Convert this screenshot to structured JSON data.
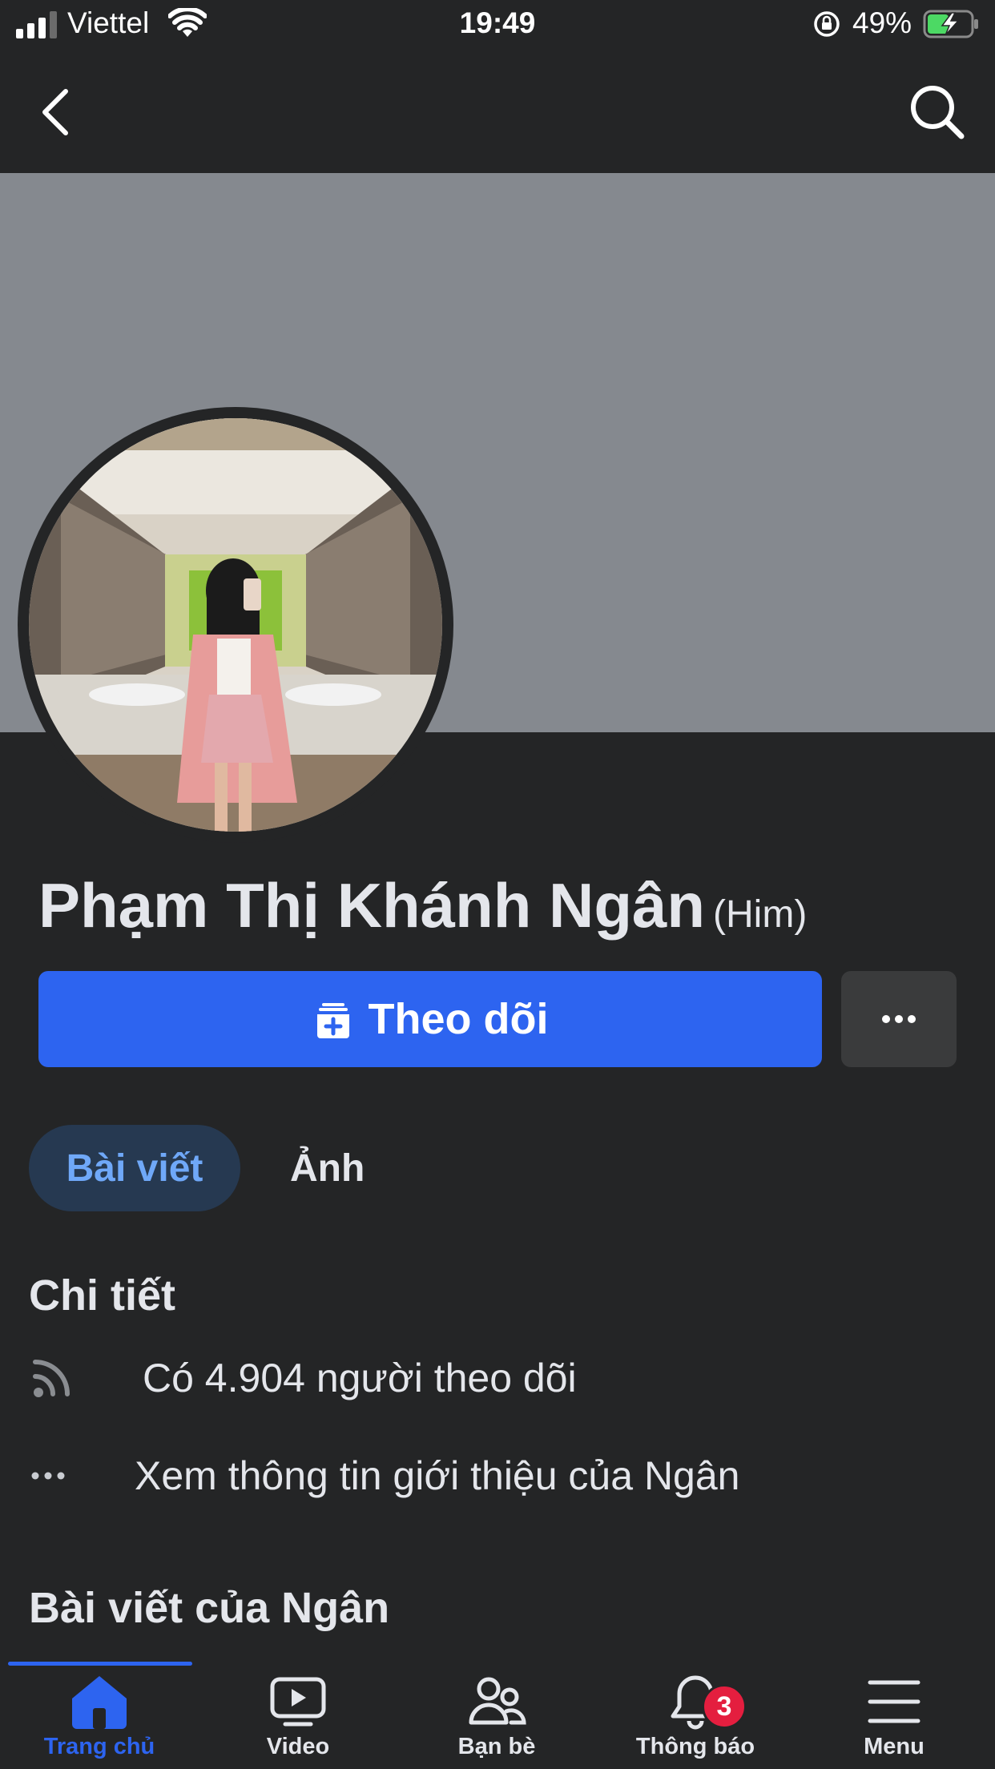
{
  "status_bar": {
    "carrier": "Viettel",
    "time": "19:49",
    "battery": "49%",
    "battery_level": 0.49
  },
  "nav": {
    "back_icon": "chevron-left-icon",
    "search_icon": "search-icon"
  },
  "profile": {
    "name": "Phạm Thị Khánh Ngân",
    "pronoun": "(Him)",
    "follow_label": "Theo dõi",
    "more_label": "..."
  },
  "tabs": [
    {
      "label": "Bài viết",
      "active": true
    },
    {
      "label": "Ảnh",
      "active": false
    }
  ],
  "details": {
    "title": "Chi tiết",
    "followers": "Có 4.904 người theo dõi",
    "about": "Xem thông tin giới thiệu của Ngân"
  },
  "posts": {
    "title": "Bài viết của Ngân"
  },
  "tabbar": {
    "items": [
      {
        "label": "Trang chủ",
        "icon": "home-icon",
        "active": true
      },
      {
        "label": "Video",
        "icon": "video-icon",
        "active": false
      },
      {
        "label": "Bạn bè",
        "icon": "friends-icon",
        "active": false
      },
      {
        "label": "Thông báo",
        "icon": "bell-icon",
        "active": false,
        "badge": "3"
      },
      {
        "label": "Menu",
        "icon": "menu-icon",
        "active": false
      }
    ]
  },
  "colors": {
    "background": "#242526",
    "accent": "#2d64f0",
    "cover": "#85898f",
    "badge": "#e41e3f"
  }
}
